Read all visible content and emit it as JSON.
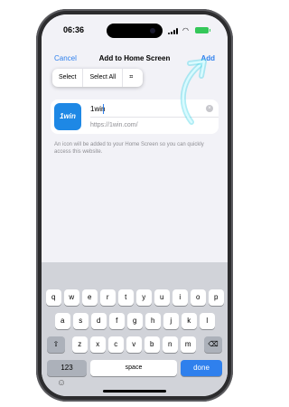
{
  "status_bar": {
    "time": "06:36"
  },
  "nav": {
    "cancel": "Cancel",
    "title": "Add to Home Screen",
    "add": "Add"
  },
  "context_menu": {
    "select": "Select",
    "select_all": "Select All",
    "scan": "⌗"
  },
  "card": {
    "icon_text": "1win",
    "name": "1win",
    "url": "https://1win.com/"
  },
  "note": "An icon will be added to your Home Screen so you can quickly access this website.",
  "keyboard": {
    "row1": [
      "q",
      "w",
      "e",
      "r",
      "t",
      "y",
      "u",
      "i",
      "o",
      "p"
    ],
    "row2": [
      "a",
      "s",
      "d",
      "f",
      "g",
      "h",
      "j",
      "k",
      "l"
    ],
    "row3": [
      "z",
      "x",
      "c",
      "v",
      "b",
      "n",
      "m"
    ],
    "numbers": "123",
    "space": "space",
    "done": "done",
    "shift": "⇧",
    "delete": "⌫",
    "globe": "☺"
  },
  "colors": {
    "accent": "#2f80ed",
    "arrow": "#4fd8e8",
    "brand_icon": "#1e88e5"
  }
}
